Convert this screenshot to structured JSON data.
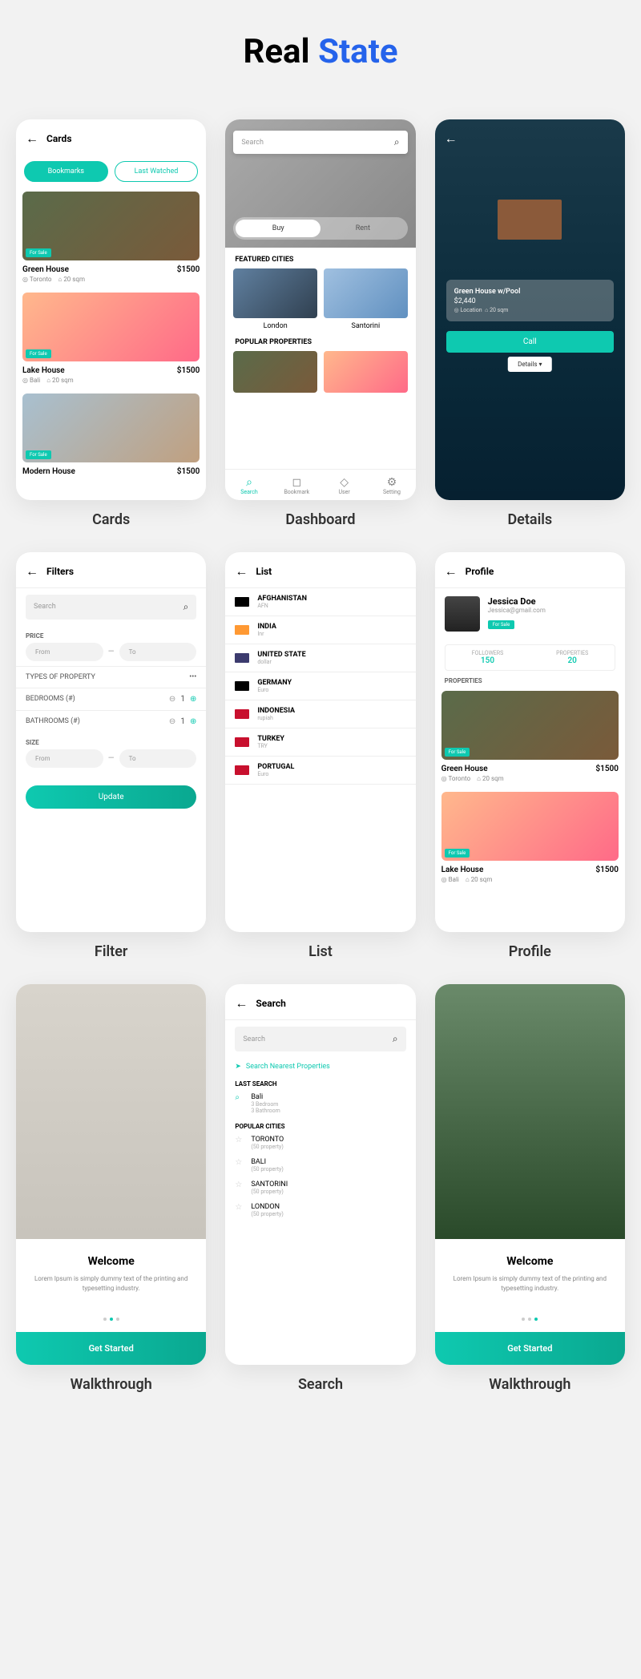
{
  "title": {
    "part1": "Real ",
    "part2": "State"
  },
  "captions": [
    "Cards",
    "Dashboard",
    "Details",
    "Filter",
    "List",
    "Profile",
    "Walkthrough",
    "Search",
    "Walkthrough"
  ],
  "cards": {
    "header": "Cards",
    "tabs": {
      "active": "Bookmarks",
      "inactive": "Last Watched"
    },
    "items": [
      {
        "badge": "For Sale",
        "name": "Green House",
        "price": "$1500",
        "city": "Toronto",
        "size": "20 sqm"
      },
      {
        "badge": "For Sale",
        "name": "Lake House",
        "price": "$1500",
        "city": "Bali",
        "size": "20 sqm"
      },
      {
        "badge": "For Sale",
        "name": "Modern House",
        "price": "$1500",
        "city": "",
        "size": ""
      }
    ]
  },
  "dashboard": {
    "search_placeholder": "Search",
    "pills": {
      "active": "Buy",
      "inactive": "Rent"
    },
    "sect_cities": "FEATURED CITIES",
    "cities": [
      "London",
      "Santorini"
    ],
    "sect_pop": "POPULAR PROPERTIES",
    "nav": [
      {
        "icon": "⌕",
        "label": "Search",
        "active": true
      },
      {
        "icon": "◻",
        "label": "Bookmark"
      },
      {
        "icon": "◇",
        "label": "User"
      },
      {
        "icon": "⚙",
        "label": "Setting"
      }
    ]
  },
  "details": {
    "title": "Green House w/Pool",
    "price": "$2,440",
    "location": "Location",
    "size": "20 sqm",
    "call": "Call",
    "details_btn": "Details  ▾"
  },
  "filter": {
    "header": "Filters",
    "search_placeholder": "Search",
    "price_label": "PRICE",
    "from": "From",
    "to": "To",
    "types_label": "TYPES OF PROPERTY",
    "bedrooms": "BEDROOMS (#)",
    "bathrooms": "BATHROOMS (#)",
    "bed_val": "1",
    "bath_val": "1",
    "size_label": "SIZE",
    "update": "Update"
  },
  "list": {
    "header": "List",
    "items": [
      {
        "name": "AFGHANISTAN",
        "sub": "AFN",
        "flag": "#000"
      },
      {
        "name": "INDIA",
        "sub": "Inr",
        "flag": "#ff9933"
      },
      {
        "name": "UNITED STATE",
        "sub": "dollar",
        "flag": "#3c3b6e"
      },
      {
        "name": "GERMANY",
        "sub": "Euro",
        "flag": "#000"
      },
      {
        "name": "INDONESIA",
        "sub": "rupiah",
        "flag": "#c8102e"
      },
      {
        "name": "TURKEY",
        "sub": "TRY",
        "flag": "#c8102e"
      },
      {
        "name": "PORTUGAL",
        "sub": "Euro",
        "flag": "#c8102e"
      }
    ]
  },
  "profile": {
    "header": "Profile",
    "name": "Jessica Doe",
    "email": "Jessica@gmail.com",
    "badge": "For Sale",
    "followers_label": "FOLLOWERS",
    "followers_val": "150",
    "properties_label": "PROPERTIES",
    "properties_val": "20",
    "sect": "PROPERTIES",
    "items": [
      {
        "badge": "For Sale",
        "name": "Green House",
        "price": "$1500",
        "city": "Toronto",
        "size": "20 sqm"
      },
      {
        "badge": "For Sale",
        "name": "Lake House",
        "price": "$1500",
        "city": "Bali",
        "size": "20 sqm"
      }
    ]
  },
  "walk": {
    "title": "Welcome",
    "text": "Lorem Ipsum is simply dummy text of the printing and typesetting industry.",
    "btn": "Get Started"
  },
  "search": {
    "header": "Search",
    "search_placeholder": "Search",
    "nearest": "Search Nearest Properties",
    "last_label": "LAST SEARCH",
    "last": {
      "name": "Bali",
      "sub1": "3 Bedroom",
      "sub2": "3 Bathroom"
    },
    "pop_label": "POPULAR CITIES",
    "pop": [
      {
        "name": "TORONTO",
        "sub": "(50 property)"
      },
      {
        "name": "BALI",
        "sub": "(50 property)"
      },
      {
        "name": "SANTORINI",
        "sub": "(50 property)"
      },
      {
        "name": "LONDON",
        "sub": "(50 property)"
      }
    ]
  }
}
